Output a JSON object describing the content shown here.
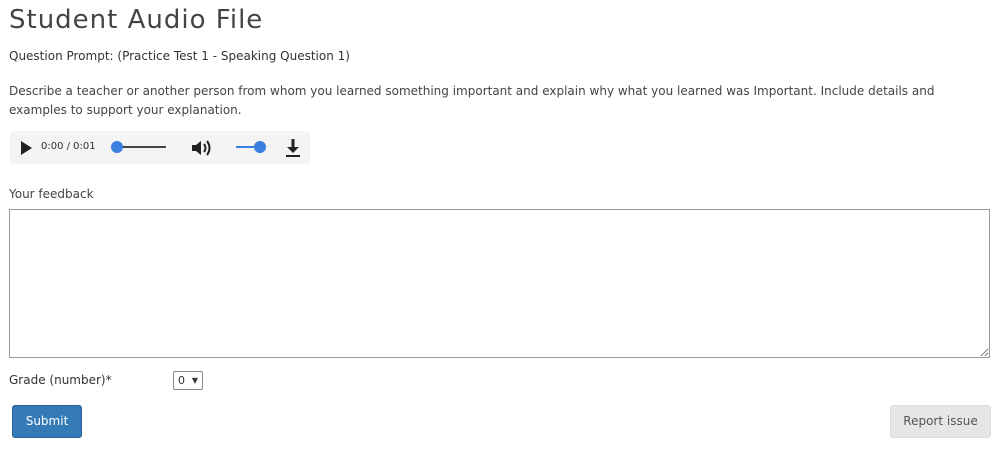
{
  "page": {
    "title": "Student Audio File",
    "prompt_heading": "Question Prompt: (Practice Test 1 - Speaking Question 1)",
    "prompt_text": "Describe a teacher or another person from whom you learned something important and explain why what you learned was Important. Include details and examples to support your explanation."
  },
  "audio": {
    "time": "0:00 / 0:01",
    "progress": 0,
    "volume": 1,
    "icons": [
      "play-icon",
      "volume-icon",
      "download-icon"
    ],
    "accent_color": "#3b7fe0"
  },
  "feedback": {
    "label": "Your feedback",
    "value": ""
  },
  "grade": {
    "label": "Grade (number)*",
    "selected": "0",
    "arrow": "▼"
  },
  "actions": {
    "submit_label": "Submit",
    "report_label": "Report issue",
    "submit_color": "#337ab7"
  }
}
